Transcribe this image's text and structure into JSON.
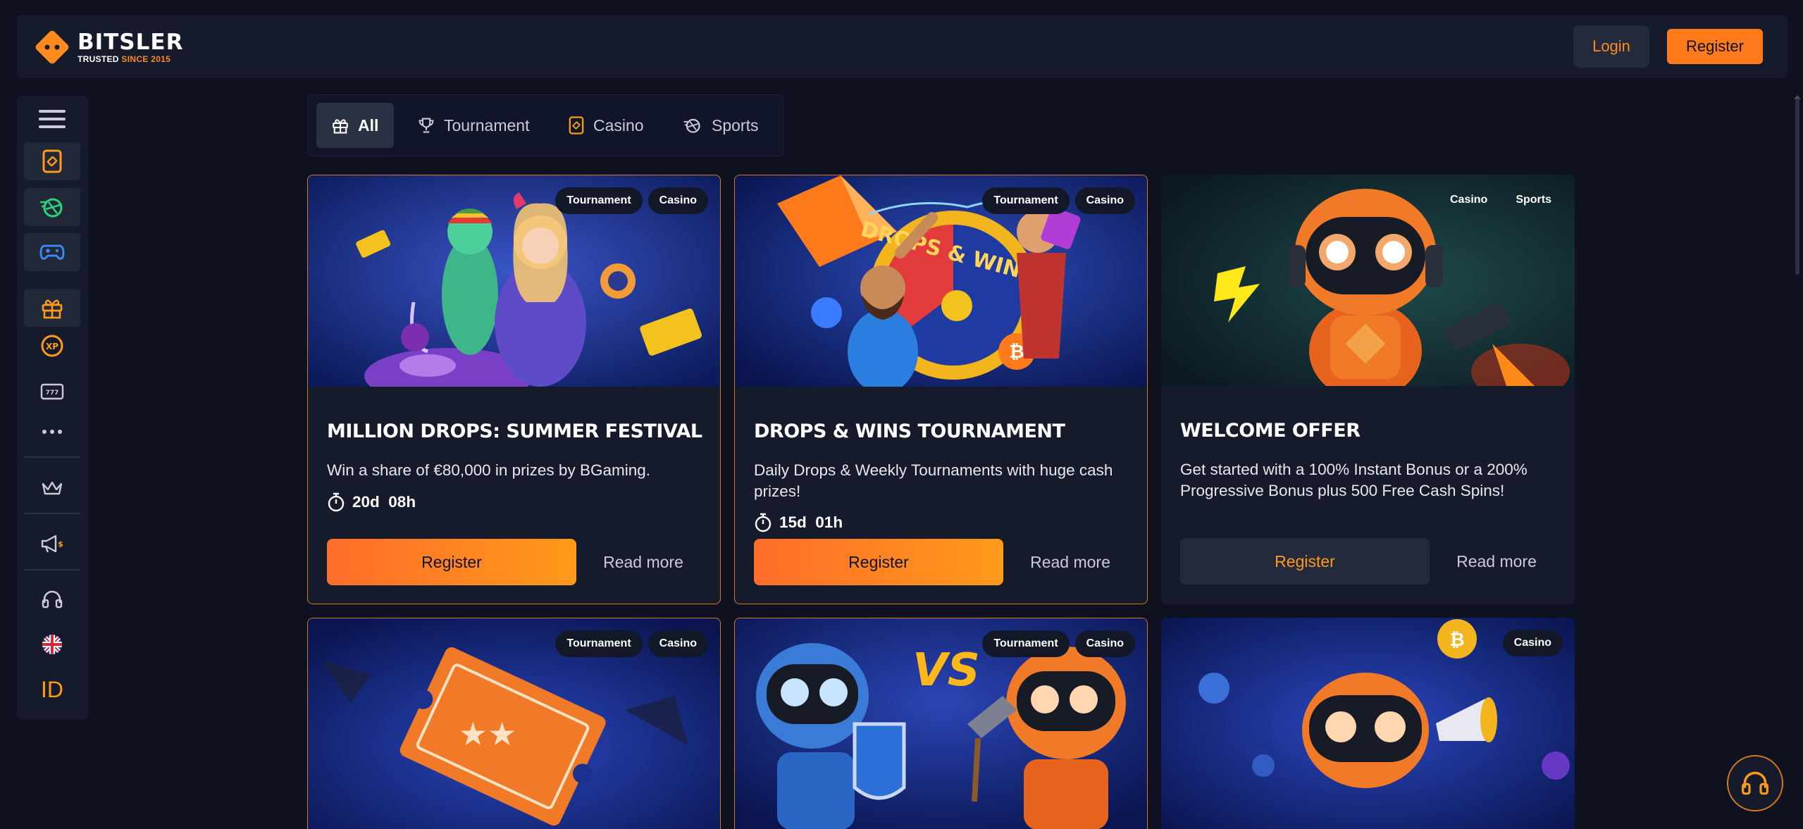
{
  "brand": {
    "name": "BITSLER",
    "tag_prefix": "TRUSTED",
    "tag_accent": "SINCE 2015"
  },
  "header": {
    "login_label": "Login",
    "register_label": "Register"
  },
  "sidebar": {
    "items": [
      "menu-icon",
      "casino-card-icon",
      "sports-ball-icon",
      "gamepad-icon",
      "gift-icon",
      "xp-icon",
      "slots-777-icon",
      "more-dots-icon",
      "crown-icon",
      "megaphone-icon",
      "headset-icon",
      "uk-flag-icon"
    ],
    "id_label": "ID"
  },
  "tabs": [
    {
      "label": "All",
      "icon": "gift-icon",
      "active": true
    },
    {
      "label": "Tournament",
      "icon": "trophy-icon",
      "active": false
    },
    {
      "label": "Casino",
      "icon": "casino-card-icon",
      "active": false
    },
    {
      "label": "Sports",
      "icon": "sports-ball-icon",
      "active": false
    }
  ],
  "cards": [
    {
      "badges": [
        "Tournament",
        "Casino"
      ],
      "title": "MILLION DROPS: SUMMER FESTIVAL",
      "description": "Win a share of €80,000 in prizes by BGaming.",
      "timer_days": "20d",
      "timer_hours": "08h",
      "register_label": "Register",
      "read_more_label": "Read more"
    },
    {
      "badges": [
        "Tournament",
        "Casino"
      ],
      "title": "DROPS & WINS TOURNAMENT",
      "description": "Daily Drops & Weekly Tournaments with huge cash prizes!",
      "timer_days": "15d",
      "timer_hours": "01h",
      "register_label": "Register",
      "read_more_label": "Read more",
      "image_text": "DROPS & WINS"
    },
    {
      "badges": [
        "Casino",
        "Sports"
      ],
      "title": "WELCOME OFFER",
      "description": "Get started with a 100% Instant Bonus or a 200% Progressive Bonus plus 500 Free Cash Spins!",
      "register_label": "Register",
      "read_more_label": "Read more"
    },
    {
      "badges": [
        "Tournament",
        "Casino"
      ]
    },
    {
      "badges": [
        "Tournament",
        "Casino"
      ],
      "image_text": "VS"
    },
    {
      "badges": [
        "Casino"
      ]
    }
  ],
  "colors": {
    "accent": "#ff8a1f",
    "background": "#0d1120",
    "panel": "#161b2b",
    "card_border": "#d8761e"
  }
}
